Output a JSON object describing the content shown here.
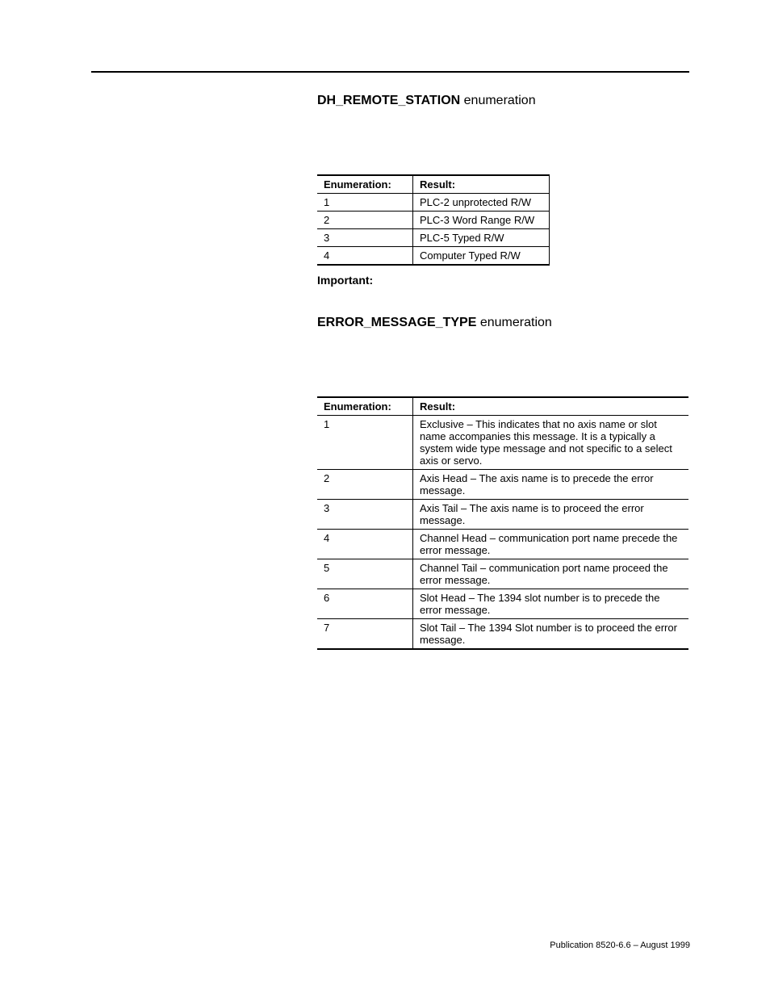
{
  "labels": {
    "enumeration_word": "enumeration",
    "important": "Important:",
    "col_enum": "Enumeration:",
    "col_result": "Result:",
    "footer": "Publication 8520-6.6 – August 1999"
  },
  "section1": {
    "title_bold": "DH_REMOTE_STATION",
    "rows": [
      {
        "n": "1",
        "r": "PLC-2 unprotected R/W"
      },
      {
        "n": "2",
        "r": "PLC-3 Word Range R/W"
      },
      {
        "n": "3",
        "r": "PLC-5 Typed R/W"
      },
      {
        "n": "4",
        "r": "Computer Typed R/W"
      }
    ]
  },
  "section2": {
    "title_bold": "ERROR_MESSAGE_TYPE",
    "rows": [
      {
        "n": "1",
        "r": "Exclusive – This indicates that no axis name or slot name accompanies this message.  It is a typically a system wide type message and not specific to a select axis or servo."
      },
      {
        "n": "2",
        "r": "Axis Head – The axis name is to precede the error message."
      },
      {
        "n": "3",
        "r": "Axis Tail – The axis name is to proceed the error message."
      },
      {
        "n": "4",
        "r": "Channel Head – communication port name precede the error message."
      },
      {
        "n": "5",
        "r": "Channel Tail – communication port name proceed the error message."
      },
      {
        "n": "6",
        "r": "Slot Head – The 1394 slot number is to precede the error message."
      },
      {
        "n": "7",
        "r": "Slot Tail – The 1394 Slot number is to proceed the error message."
      }
    ]
  }
}
